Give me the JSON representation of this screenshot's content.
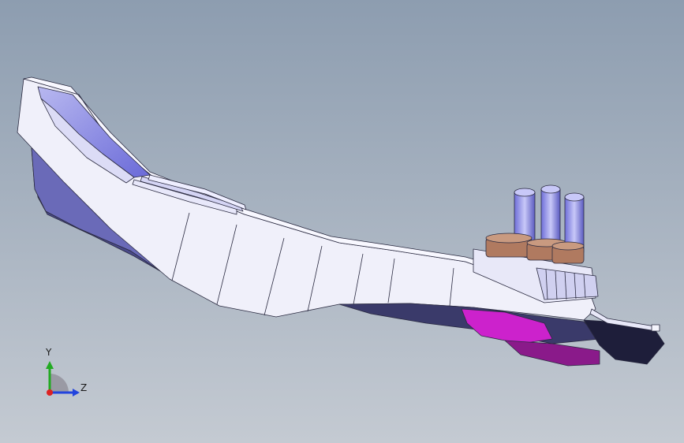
{
  "viewport": {
    "background_top": "#8d9db0",
    "background_bottom": "#c4cad2"
  },
  "model": {
    "body_colors": {
      "top_face": "#f4f4fc",
      "side_face": "#e6e6f4",
      "shadow_face": "#7a7ac8",
      "dark_face": "#4a4a8a",
      "edge": "#2a2a40"
    },
    "accent_colors": {
      "pin": "#9a9ae8",
      "collar": "#b07a60",
      "clip": "#cc22cc",
      "tip": "#1e1e3a"
    }
  },
  "triad": {
    "y_label": "Y",
    "z_label": "Z",
    "x_color": "#dd2222",
    "y_color": "#22aa22",
    "z_color": "#2244dd"
  }
}
